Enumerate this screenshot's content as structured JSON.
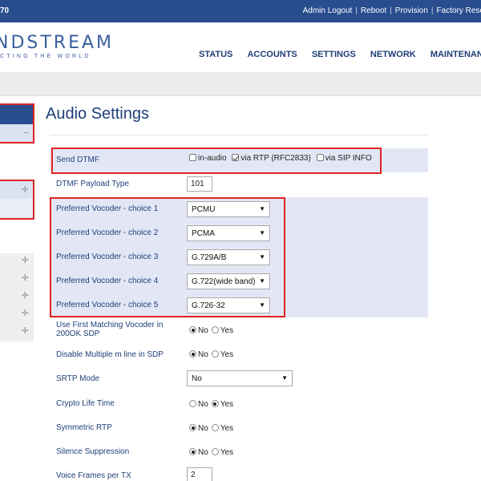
{
  "topbar": {
    "model": "70",
    "links": [
      "Admin Logout",
      "Reboot",
      "Provision",
      "Factory Rese"
    ]
  },
  "header": {
    "logo": "NDSTREAM",
    "tagline": "CTING THE WORLD",
    "nav": [
      "STATUS",
      "ACCOUNTS",
      "SETTINGS",
      "NETWORK",
      "MAINTENANCE"
    ]
  },
  "sidebar_icons": {
    "minus": "−",
    "plus": "✛"
  },
  "page": {
    "title": "Audio Settings"
  },
  "send_dtmf": {
    "label": "Send DTMF",
    "options": [
      {
        "label": "in-audio",
        "checked": false
      },
      {
        "label": "via RTP (RFC2833)",
        "checked": true
      },
      {
        "label": "via SIP INFO",
        "checked": false
      }
    ]
  },
  "dtmf_payload": {
    "label": "DTMF Payload Type",
    "value": "101"
  },
  "vocoders": [
    {
      "label": "Preferred Vocoder - choice 1",
      "value": "PCMU"
    },
    {
      "label": "Preferred Vocoder - choice 2",
      "value": "PCMA"
    },
    {
      "label": "Preferred Vocoder - choice 3",
      "value": "G.729A/B"
    },
    {
      "label": "Preferred Vocoder - choice 4",
      "value": "G.722(wide band)"
    },
    {
      "label": "Preferred Vocoder - choice 5",
      "value": "G.726-32"
    }
  ],
  "first_match": {
    "label_line1": "Use First Matching Vocoder in",
    "label_line2": "200OK SDP",
    "selected": "No"
  },
  "disable_mline": {
    "label": "Disable Multiple m line in SDP",
    "selected": "No"
  },
  "srtp": {
    "label": "SRTP Mode",
    "value": "No"
  },
  "crypto": {
    "label": "Crypto Life Time",
    "selected": "Yes"
  },
  "symmetric_rtp": {
    "label": "Symmetric RTP",
    "selected": "No"
  },
  "silence": {
    "label": "Silence Suppression",
    "selected": "No"
  },
  "voice_frames": {
    "label": "Voice Frames per TX",
    "value": "2"
  },
  "radio_labels": {
    "no": "No",
    "yes": "Yes"
  },
  "select_arrow": "▼",
  "highlight_color": "#e02424"
}
